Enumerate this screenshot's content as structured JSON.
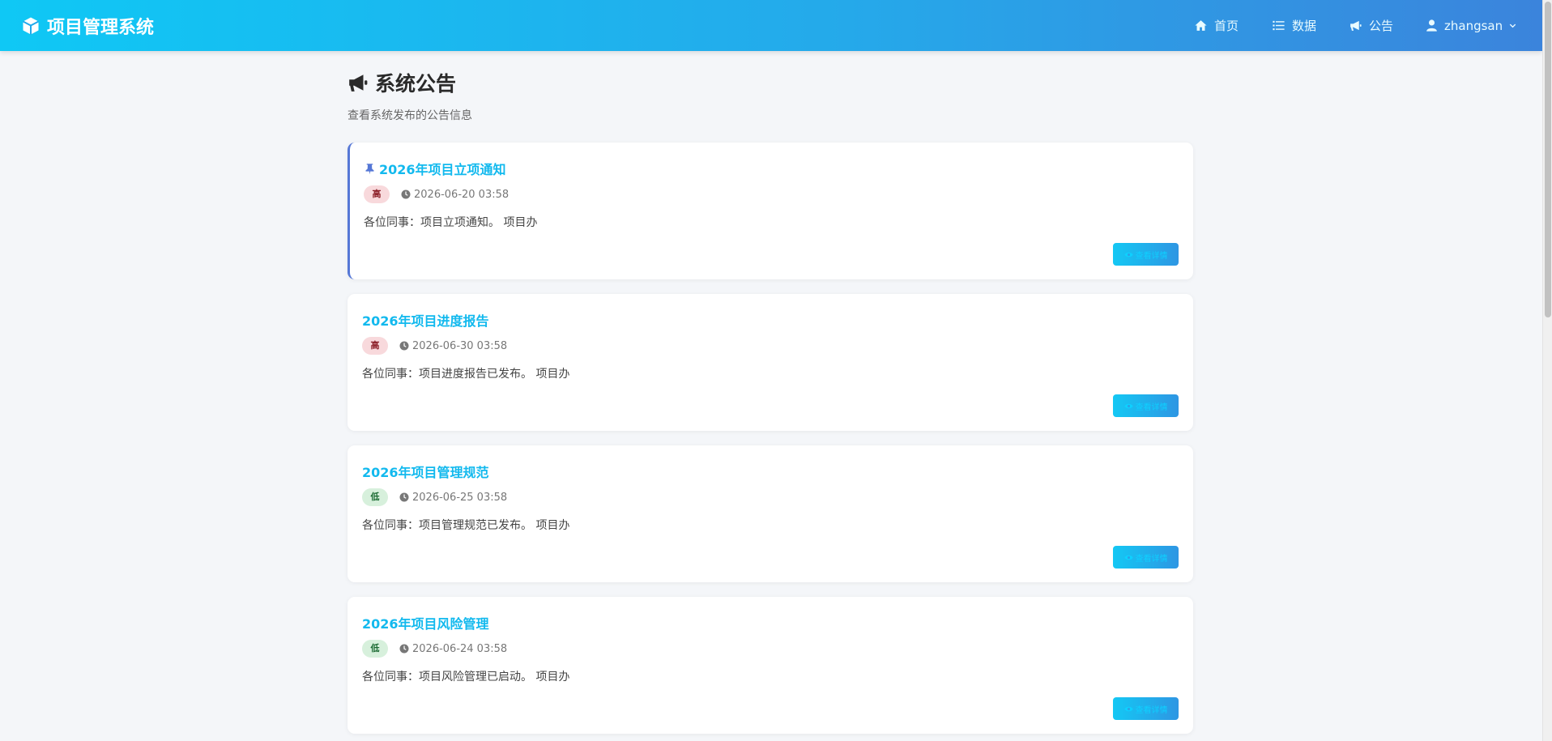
{
  "brand": {
    "title": "项目管理系统",
    "icon": "cube-icon"
  },
  "nav": {
    "home": "首页",
    "data": "数据",
    "notice": "公告",
    "user": "zhangsan"
  },
  "page": {
    "title": "系统公告",
    "subtitle": "查看系统发布的公告信息"
  },
  "notices": [
    {
      "pinned": true,
      "title": "2026年项目立项通知",
      "priority": "高",
      "level": "high",
      "date": "2026-06-20 03:58",
      "content": "各位同事：项目立项通知。 项目办",
      "button": "查看详情"
    },
    {
      "pinned": false,
      "title": "2026年项目进度报告",
      "priority": "高",
      "level": "high",
      "date": "2026-06-30 03:58",
      "content": "各位同事：项目进度报告已发布。 项目办",
      "button": "查看详情"
    },
    {
      "pinned": false,
      "title": "2026年项目管理规范",
      "priority": "低",
      "level": "low",
      "date": "2026-06-25 03:58",
      "content": "各位同事：项目管理规范已发布。 项目办",
      "button": "查看详情"
    },
    {
      "pinned": false,
      "title": "2026年项目风险管理",
      "priority": "低",
      "level": "low",
      "date": "2026-06-24 03:58",
      "content": "各位同事：项目风险管理已启动。 项目办",
      "button": "查看详情"
    }
  ],
  "colors": {
    "nav_gradient_start": "#0fc8f5",
    "nav_gradient_end": "#3b84dc",
    "title_blue": "#12b9ee",
    "high_badge": "#f8d9dc",
    "low_badge": "#d7f0dc"
  }
}
